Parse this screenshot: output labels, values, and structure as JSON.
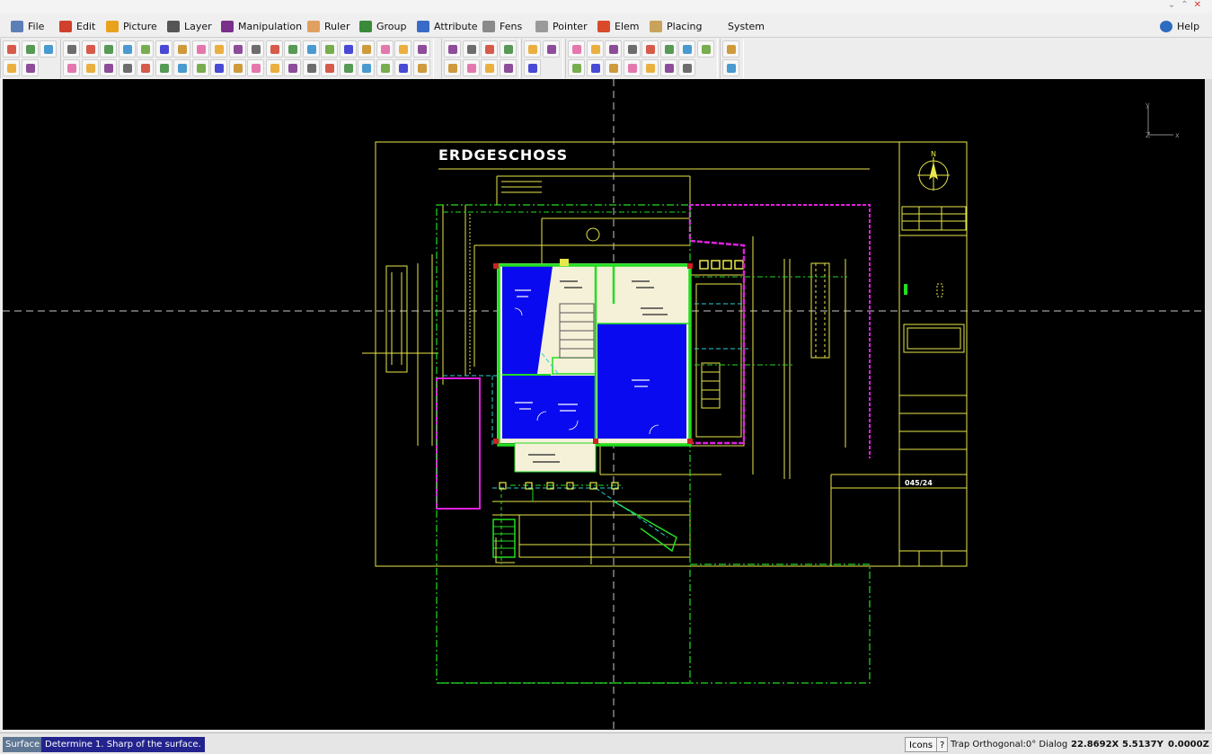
{
  "menu": [
    {
      "label": "File",
      "name": "menu-file",
      "icon": "file-icon",
      "color": "#5c7fb8"
    },
    {
      "label": "Edit",
      "name": "menu-edit",
      "icon": "pencil-icon",
      "color": "#d0402c"
    },
    {
      "label": "Picture",
      "name": "menu-picture",
      "icon": "picture-icon",
      "color": "#e8a21e"
    },
    {
      "label": "Layer",
      "name": "menu-layer",
      "icon": "layers-icon",
      "color": "#555555"
    },
    {
      "label": "Manipulation",
      "name": "menu-manipulation",
      "icon": "rotate-icon",
      "color": "#7a2f8a"
    },
    {
      "label": "Ruler",
      "name": "menu-ruler",
      "icon": "ruler-icon",
      "color": "#e0a060"
    },
    {
      "label": "Group",
      "name": "menu-group",
      "icon": "group-icon",
      "color": "#3a8a3a"
    },
    {
      "label": "Attribute",
      "name": "menu-attribute",
      "icon": "attribute-icon",
      "color": "#3a6ac8"
    },
    {
      "label": "Fens",
      "name": "menu-fens",
      "icon": "window-icon",
      "color": "#8a8a8a"
    },
    {
      "label": "Pointer",
      "name": "menu-pointer",
      "icon": "pointer-icon",
      "color": "#9a9a9a"
    },
    {
      "label": "Elem",
      "name": "menu-elem",
      "icon": "elements-icon",
      "color": "#d84a2a"
    },
    {
      "label": "Placing",
      "name": "menu-placing",
      "icon": "placing-icon",
      "color": "#c9a35a"
    },
    {
      "label": "System",
      "name": "menu-system",
      "icon": "",
      "color": ""
    },
    {
      "label": "Help",
      "name": "menu-help",
      "icon": "info-icon",
      "color": "#2d6cc0"
    }
  ],
  "drawing": {
    "title": "ERDGESCHOSS",
    "plan_number": "045/24",
    "north_label": "N",
    "axis_y": "y",
    "axis_x": "x",
    "axis_z": "Z"
  },
  "status": {
    "mode": "Surface",
    "prompt": "Determine 1. Sharp of the surface.",
    "icons_button": "Icons",
    "help_button": "?",
    "trap": "Trap Orthogonal:0° Dialog",
    "x": "22.8692X",
    "y": "5.5137Y",
    "z": "0.0000Z"
  },
  "colors": {
    "canvas_bg": "#000000",
    "plan_yellow": "#e8e84a",
    "plan_green": "#22dd22",
    "plan_magenta": "#e020e0",
    "plan_blue": "#0a0af0",
    "plan_cream": "#f5f0d8",
    "axis_gray": "#c8c8c8"
  }
}
